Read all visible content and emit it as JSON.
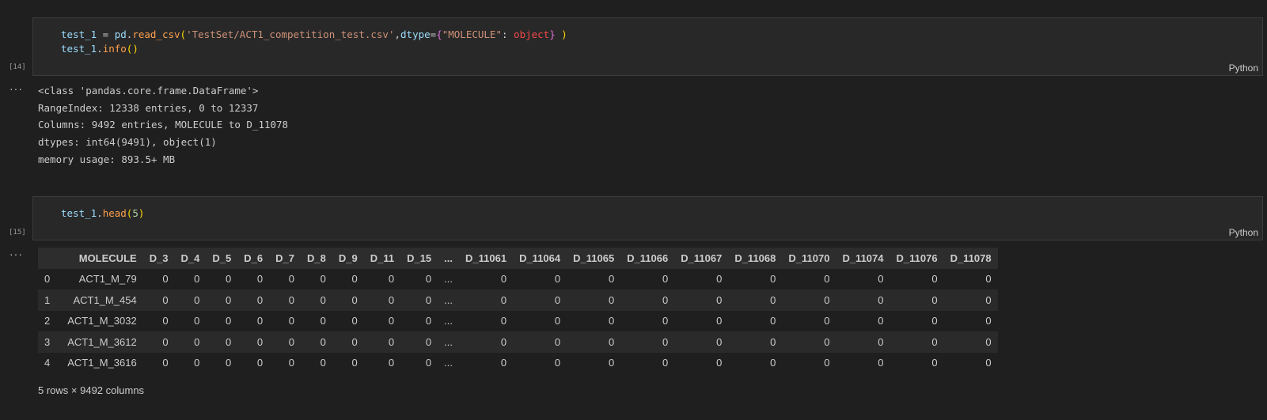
{
  "cells": [
    {
      "exec_count": "[14]",
      "language": "Python",
      "code": [
        [
          {
            "t": "test_1",
            "c": "var"
          },
          {
            "t": " = ",
            "c": "plain"
          },
          {
            "t": "pd",
            "c": "var"
          },
          {
            "t": ".",
            "c": "plain"
          },
          {
            "t": "read_csv",
            "c": "mth"
          },
          {
            "t": "(",
            "c": "br1"
          },
          {
            "t": "'TestSet/ACT1_competition_test.csv'",
            "c": "str"
          },
          {
            "t": ",",
            "c": "plain"
          },
          {
            "t": "dtype",
            "c": "var"
          },
          {
            "t": "=",
            "c": "plain"
          },
          {
            "t": "{",
            "c": "br2"
          },
          {
            "t": "\"MOLECULE\"",
            "c": "str"
          },
          {
            "t": ": ",
            "c": "plain"
          },
          {
            "t": "object",
            "c": "kw"
          },
          {
            "t": "}",
            "c": "br2"
          },
          {
            "t": " )",
            "c": "br1"
          }
        ],
        [
          {
            "t": "test_1",
            "c": "var"
          },
          {
            "t": ".",
            "c": "plain"
          },
          {
            "t": "info",
            "c": "mth"
          },
          {
            "t": "()",
            "c": "br1"
          }
        ]
      ],
      "output_lines": [
        "<class 'pandas.core.frame.DataFrame'>",
        "RangeIndex: 12338 entries, 0 to 12337",
        "Columns: 9492 entries, MOLECULE to D_11078",
        "dtypes: int64(9491), object(1)",
        "memory usage: 893.5+ MB"
      ]
    },
    {
      "exec_count": "[15]",
      "language": "Python",
      "code": [
        [
          {
            "t": "test_1",
            "c": "var"
          },
          {
            "t": ".",
            "c": "plain"
          },
          {
            "t": "head",
            "c": "mth"
          },
          {
            "t": "(",
            "c": "br1"
          },
          {
            "t": "5",
            "c": "num"
          },
          {
            "t": ")",
            "c": "br1"
          }
        ]
      ]
    }
  ],
  "output_menu_icon": "ellipsis-icon",
  "dataframe": {
    "columns": [
      "",
      "MOLECULE",
      "D_3",
      "D_4",
      "D_5",
      "D_6",
      "D_7",
      "D_8",
      "D_9",
      "D_11",
      "D_15",
      "...",
      "D_11061",
      "D_11064",
      "D_11065",
      "D_11066",
      "D_11067",
      "D_11068",
      "D_11070",
      "D_11074",
      "D_11076",
      "D_11078"
    ],
    "rows": [
      [
        "0",
        "ACT1_M_79",
        "0",
        "0",
        "0",
        "0",
        "0",
        "0",
        "0",
        "0",
        "0",
        "...",
        "0",
        "0",
        "0",
        "0",
        "0",
        "0",
        "0",
        "0",
        "0",
        "0"
      ],
      [
        "1",
        "ACT1_M_454",
        "0",
        "0",
        "0",
        "0",
        "0",
        "0",
        "0",
        "0",
        "0",
        "...",
        "0",
        "0",
        "0",
        "0",
        "0",
        "0",
        "0",
        "0",
        "0",
        "0"
      ],
      [
        "2",
        "ACT1_M_3032",
        "0",
        "0",
        "0",
        "0",
        "0",
        "0",
        "0",
        "0",
        "0",
        "...",
        "0",
        "0",
        "0",
        "0",
        "0",
        "0",
        "0",
        "0",
        "0",
        "0"
      ],
      [
        "3",
        "ACT1_M_3612",
        "0",
        "0",
        "0",
        "0",
        "0",
        "0",
        "0",
        "0",
        "0",
        "...",
        "0",
        "0",
        "0",
        "0",
        "0",
        "0",
        "0",
        "0",
        "0",
        "0"
      ],
      [
        "4",
        "ACT1_M_3616",
        "0",
        "0",
        "0",
        "0",
        "0",
        "0",
        "0",
        "0",
        "0",
        "...",
        "0",
        "0",
        "0",
        "0",
        "0",
        "0",
        "0",
        "0",
        "0",
        "0"
      ]
    ],
    "shape_note": "5 rows × 9492 columns"
  },
  "colors": {
    "background": "#1f1f1f",
    "cell_background": "#282828",
    "variable": "#9cdcfe",
    "string": "#ce9178",
    "method": "#ffa04d",
    "bracket_gold": "#ffd700",
    "bracket_magenta": "#da70d6"
  }
}
